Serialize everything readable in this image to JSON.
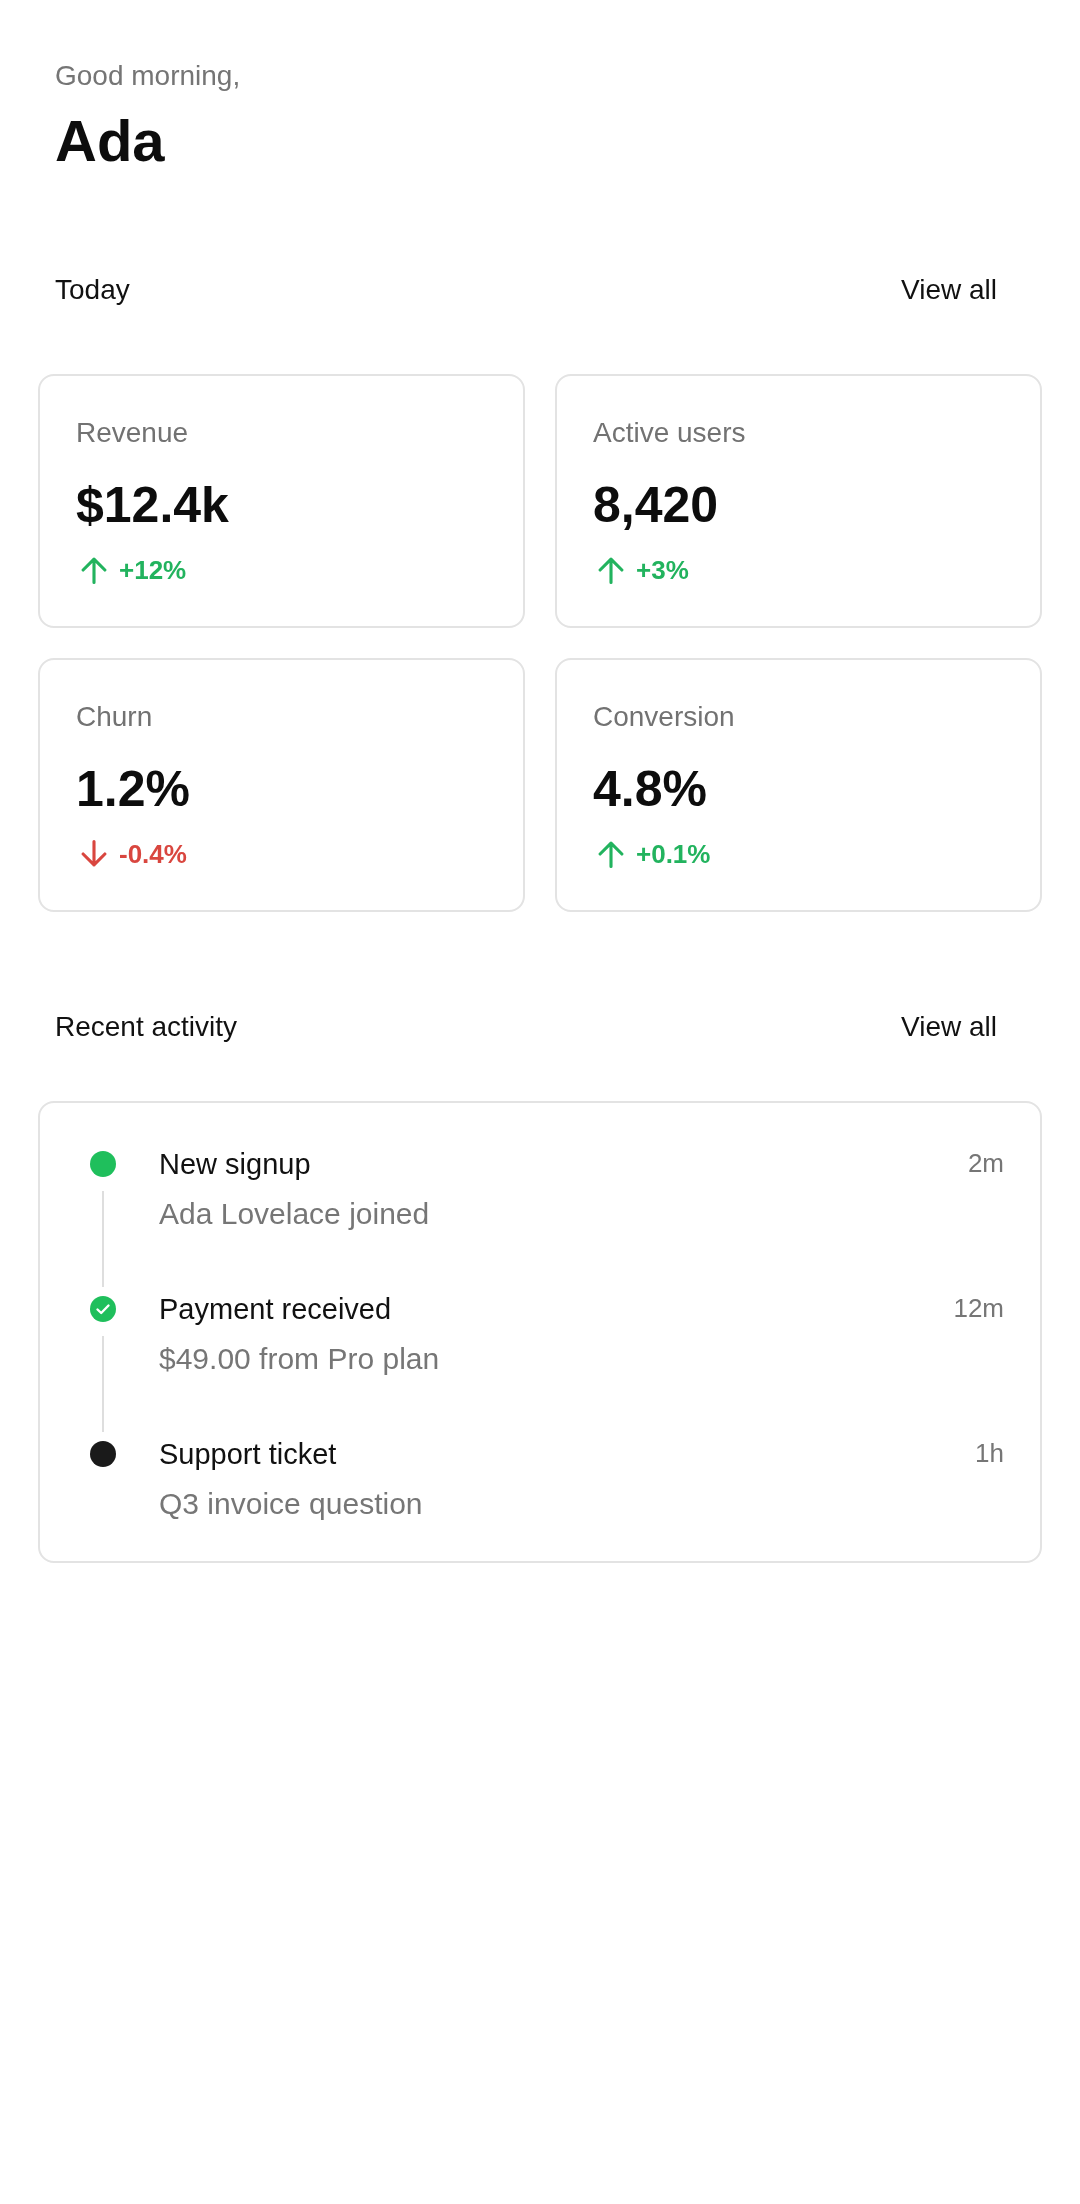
{
  "greeting": {
    "salutation": "Good morning,",
    "name": "Ada"
  },
  "today": {
    "title": "Today",
    "action": "View all",
    "metrics": [
      {
        "label": "Revenue",
        "value": "$12.4k",
        "change": "+12%",
        "kind": "up"
      },
      {
        "label": "Active users",
        "value": "8,420",
        "change": "+3%",
        "kind": "up"
      },
      {
        "label": "Churn",
        "value": "1.2%",
        "change": "-0.4%",
        "kind": "down"
      },
      {
        "label": "Conversion",
        "value": "4.8%",
        "change": "+0.1%",
        "kind": "up"
      }
    ]
  },
  "recent_activity": {
    "title": "Recent activity",
    "action": "View all",
    "items": [
      {
        "kind": "dot",
        "color": "#1fbf5c",
        "title": "New signup",
        "detail": "Ada Lovelace joined",
        "time": "2m"
      },
      {
        "kind": "check",
        "color": "#1fbf5c",
        "title": "Payment received",
        "detail": "$49.00 from Pro plan",
        "time": "12m"
      },
      {
        "kind": "dot",
        "color": "#1a1a1a",
        "title": "Support ticket",
        "detail": "Q3 invoice question",
        "time": "1h"
      }
    ]
  }
}
